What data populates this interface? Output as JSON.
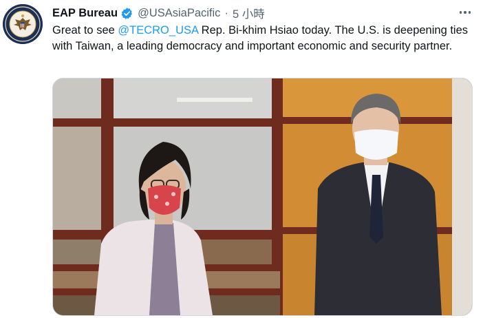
{
  "tweet": {
    "author_name": "EAP Bureau",
    "handle": "@USAsiaPacific",
    "separator": "·",
    "time": "5 小時",
    "text_before": "Great to see ",
    "mention": "@TECRO_USA",
    "text_after": " Rep. Bi-khim Hsiao today. The U.S. is deepening ties with Taiwan, a leading democracy and important economic and security partner.",
    "avatar_icon": "state-department-seal-icon",
    "verified_icon": "verified-badge-icon",
    "more_icon": "more-options-icon",
    "photo_description_icon": "photo-image"
  },
  "colors": {
    "text": "#0f1419",
    "secondary": "#536471",
    "link": "#1d9bf0",
    "verified": "#1d9bf0"
  }
}
